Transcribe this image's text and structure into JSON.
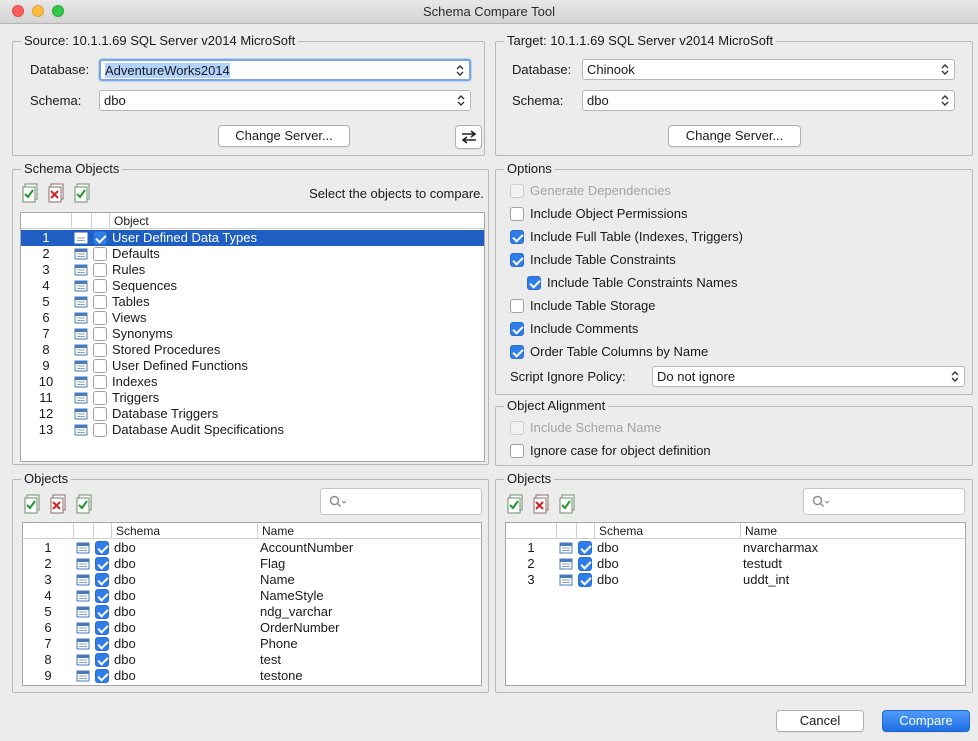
{
  "window": {
    "title": "Schema Compare Tool"
  },
  "source": {
    "legend": "Source: 10.1.1.69 SQL Server v2014 MicroSoft",
    "database_label": "Database:",
    "database_value": "AdventureWorks2014",
    "schema_label": "Schema:",
    "schema_value": "dbo",
    "change_server": "Change Server..."
  },
  "target": {
    "legend": "Target: 10.1.1.69 SQL Server v2014 MicroSoft",
    "database_label": "Database:",
    "database_value": "Chinook",
    "schema_label": "Schema:",
    "schema_value": "dbo",
    "change_server": "Change Server..."
  },
  "schema_objects": {
    "legend": "Schema Objects",
    "hint": "Select the objects to compare.",
    "column_object": "Object",
    "items": [
      {
        "n": "1",
        "label": "User Defined Data Types",
        "checked": true,
        "selected": true,
        "icon": "udt-icon"
      },
      {
        "n": "2",
        "label": "Defaults",
        "checked": false,
        "icon": "default-icon"
      },
      {
        "n": "3",
        "label": "Rules",
        "checked": false,
        "icon": "rule-icon"
      },
      {
        "n": "4",
        "label": "Sequences",
        "checked": false,
        "icon": "sequence-icon"
      },
      {
        "n": "5",
        "label": "Tables",
        "checked": false,
        "icon": "table-icon"
      },
      {
        "n": "6",
        "label": "Views",
        "checked": false,
        "icon": "view-icon"
      },
      {
        "n": "7",
        "label": "Synonyms",
        "checked": false,
        "icon": "synonym-icon"
      },
      {
        "n": "8",
        "label": "Stored Procedures",
        "checked": false,
        "icon": "procedure-icon"
      },
      {
        "n": "9",
        "label": "User Defined Functions",
        "checked": false,
        "icon": "function-icon"
      },
      {
        "n": "10",
        "label": "Indexes",
        "checked": false,
        "icon": "index-icon"
      },
      {
        "n": "11",
        "label": "Triggers",
        "checked": false,
        "icon": "trigger-icon"
      },
      {
        "n": "12",
        "label": "Database Triggers",
        "checked": false,
        "icon": "db-trigger-icon"
      },
      {
        "n": "13",
        "label": "Database Audit Specifications",
        "checked": false,
        "icon": "audit-icon"
      }
    ]
  },
  "options": {
    "legend": "Options",
    "items": [
      {
        "label": "Generate Dependencies",
        "checked": false,
        "disabled": true,
        "indent": false
      },
      {
        "label": "Include Object Permissions",
        "checked": false,
        "disabled": false,
        "indent": false
      },
      {
        "label": "Include Full Table (Indexes, Triggers)",
        "checked": true,
        "disabled": false,
        "indent": false
      },
      {
        "label": "Include Table Constraints",
        "checked": true,
        "disabled": false,
        "indent": false
      },
      {
        "label": "Include Table Constraints Names",
        "checked": true,
        "disabled": false,
        "indent": true
      },
      {
        "label": "Include Table Storage",
        "checked": false,
        "disabled": false,
        "indent": false
      },
      {
        "label": "Include Comments",
        "checked": true,
        "disabled": false,
        "indent": false
      },
      {
        "label": "Order Table Columns by Name",
        "checked": true,
        "disabled": false,
        "indent": false
      }
    ],
    "ignore_policy_label": "Script Ignore Policy:",
    "ignore_policy_value": "Do not ignore"
  },
  "alignment": {
    "legend": "Object Alignment",
    "items": [
      {
        "label": "Include Schema Name",
        "checked": false,
        "disabled": true
      },
      {
        "label": "Ignore case for object definition",
        "checked": false,
        "disabled": false
      }
    ]
  },
  "source_objects": {
    "legend": "Objects",
    "col_schema": "Schema",
    "col_name": "Name",
    "rows": [
      {
        "n": "1",
        "schema": "dbo",
        "name": "AccountNumber"
      },
      {
        "n": "2",
        "schema": "dbo",
        "name": "Flag"
      },
      {
        "n": "3",
        "schema": "dbo",
        "name": "Name"
      },
      {
        "n": "4",
        "schema": "dbo",
        "name": "NameStyle"
      },
      {
        "n": "5",
        "schema": "dbo",
        "name": "ndg_varchar"
      },
      {
        "n": "6",
        "schema": "dbo",
        "name": "OrderNumber"
      },
      {
        "n": "7",
        "schema": "dbo",
        "name": "Phone"
      },
      {
        "n": "8",
        "schema": "dbo",
        "name": "test"
      },
      {
        "n": "9",
        "schema": "dbo",
        "name": "testone"
      }
    ]
  },
  "target_objects": {
    "legend": "Objects",
    "col_schema": "Schema",
    "col_name": "Name",
    "rows": [
      {
        "n": "1",
        "schema": "dbo",
        "name": "nvarcharmax"
      },
      {
        "n": "2",
        "schema": "dbo",
        "name": "testudt"
      },
      {
        "n": "3",
        "schema": "dbo",
        "name": "uddt_int"
      }
    ]
  },
  "footer": {
    "cancel": "Cancel",
    "compare": "Compare"
  },
  "colors": {
    "accent": "#2f7de8",
    "selection": "#1f5fc4"
  }
}
